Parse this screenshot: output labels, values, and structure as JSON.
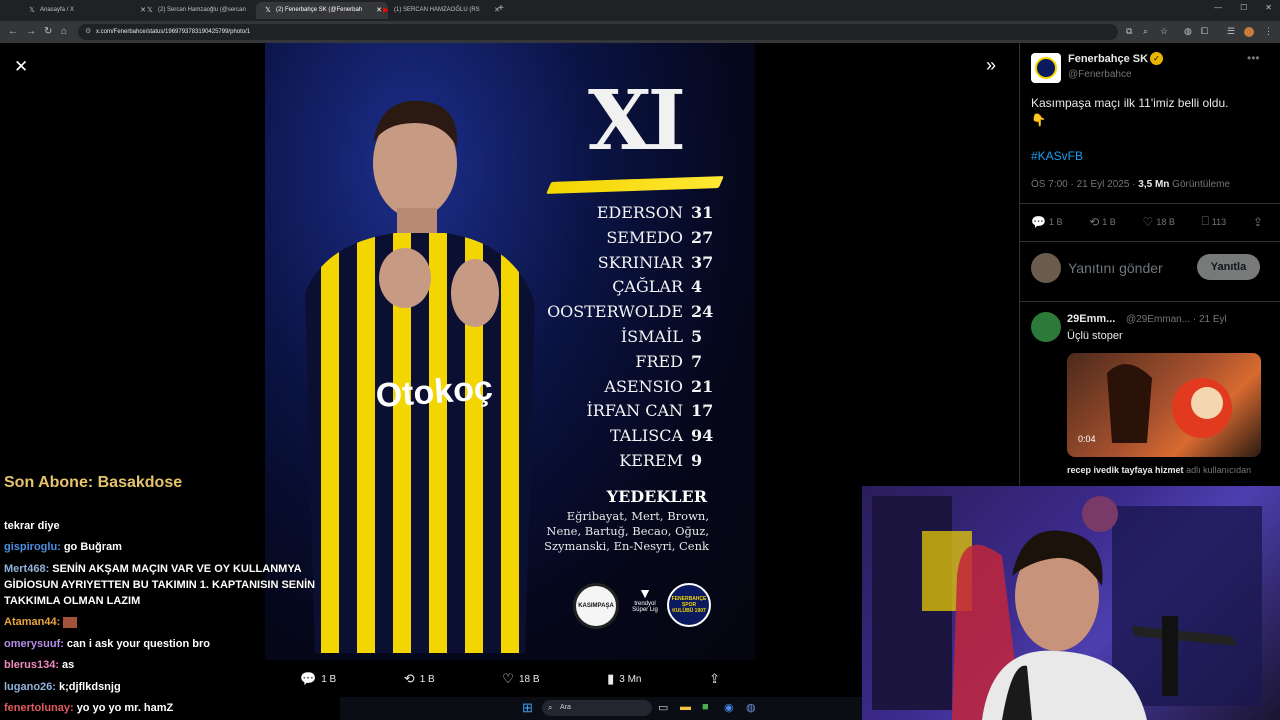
{
  "browser": {
    "tabs": [
      {
        "title": "Anasayfa / X",
        "active": false
      },
      {
        "title": "(2) Sercan Hamzaoğlu (@sercan",
        "active": false
      },
      {
        "title": "(2) Fenerbahçe SK (@Fenerbah",
        "active": true
      },
      {
        "title": "(1) SERCAN HAMZAOĞLU (RS",
        "active": false
      }
    ],
    "url": "x.com/Fenerbahce/status/1969793783190425799/photo/1"
  },
  "poster": {
    "heading": "XI",
    "jersey_text": "Otokoç",
    "lineup": [
      {
        "name": "EDERSON",
        "number": "31"
      },
      {
        "name": "SEMEDO",
        "number": "27"
      },
      {
        "name": "SKRINIAR",
        "number": "37"
      },
      {
        "name": "ÇAĞLAR",
        "number": "4"
      },
      {
        "name": "OOSTERWOLDE",
        "number": "24"
      },
      {
        "name": "İSMAİL",
        "number": "5"
      },
      {
        "name": "FRED",
        "number": "7"
      },
      {
        "name": "ASENSIO",
        "number": "21"
      },
      {
        "name": "İRFAN CAN",
        "number": "17"
      },
      {
        "name": "TALISCA",
        "number": "94"
      },
      {
        "name": "KEREM",
        "number": "9"
      }
    ],
    "subs_title": "YEDEKLER",
    "subs_text": "Eğribayat, Mert, Brown, Nene, Bartuğ, Becao, Oğuz, Szymanski, En-Nesyri, Cenk",
    "logo_left": "KASIMPAŞA",
    "logo_mid": "trendyol Süper Lig",
    "logo_right": "FENERBAHÇE SPOR KULÜBÜ 1907"
  },
  "viewer_actions": {
    "replies": "1 B",
    "reposts": "1 B",
    "likes": "18 B",
    "views": "3 Mn"
  },
  "chat": {
    "sub_line": "Son Abone: Basakdose",
    "messages": [
      {
        "user": "",
        "text": "tekrar diye",
        "color": "#ffffff"
      },
      {
        "user": "gispiroglu:",
        "text": "go Buğram",
        "color": "#4a90e2"
      },
      {
        "user": "Mert468:",
        "text": "SENİN AKŞAM MAÇIN VAR VE OY KULLANMYA GİDİOSUN AYRIYETTEN BU TAKIMIN 1. KAPTANISIN SENİN TAKKIMLA OLMAN LAZIM",
        "color": "#8fb3d9"
      },
      {
        "user": "Ataman44:",
        "text": "",
        "color": "#e8a33c"
      },
      {
        "user": "omerysuuf:",
        "text": "can i ask your question bro",
        "color": "#b58ee8"
      },
      {
        "user": "blerus134:",
        "text": "as",
        "color": "#f08ac0"
      },
      {
        "user": "lugano26:",
        "text": "k;djflkdsnjg",
        "color": "#8fb3d9"
      },
      {
        "user": "fenertolunay:",
        "text": "yo yo yo mr. hamZ",
        "color": "#e05c5c"
      }
    ]
  },
  "tweet": {
    "author_name": "Fenerbahçe SK",
    "author_handle": "@Fenerbahce",
    "text": "Kasımpaşa maçı ilk 11'imiz belli oldu.",
    "emoji": "👇",
    "hashtag": "#KASvFB",
    "time": "ÖS 7:00 · 21 Eyl 2025 · ",
    "views_count": "3,5 Mn",
    "views_label": " Görüntüleme",
    "stats": {
      "replies": "1 B",
      "reposts": "1 B",
      "likes": "18 B",
      "bookmarks": "113"
    },
    "reply_placeholder": "Yanıtını gönder",
    "reply_button": "Yanıtla"
  },
  "reply": {
    "name": "29Emm...",
    "handle": "@29Emman... · 21 Eyl",
    "text": "Üçlü stoper",
    "video_time": "0:04",
    "caption": "recep ivedik tayfaya hizmet",
    "caption_suffix": " adlı kullanıcıdan"
  },
  "taskbar": {
    "search_placeholder": "Ara"
  },
  "colors": {
    "accent_blue": "#1d9bf0",
    "fb_yellow": "#f3d600",
    "fb_navy": "#0b1a5e"
  }
}
